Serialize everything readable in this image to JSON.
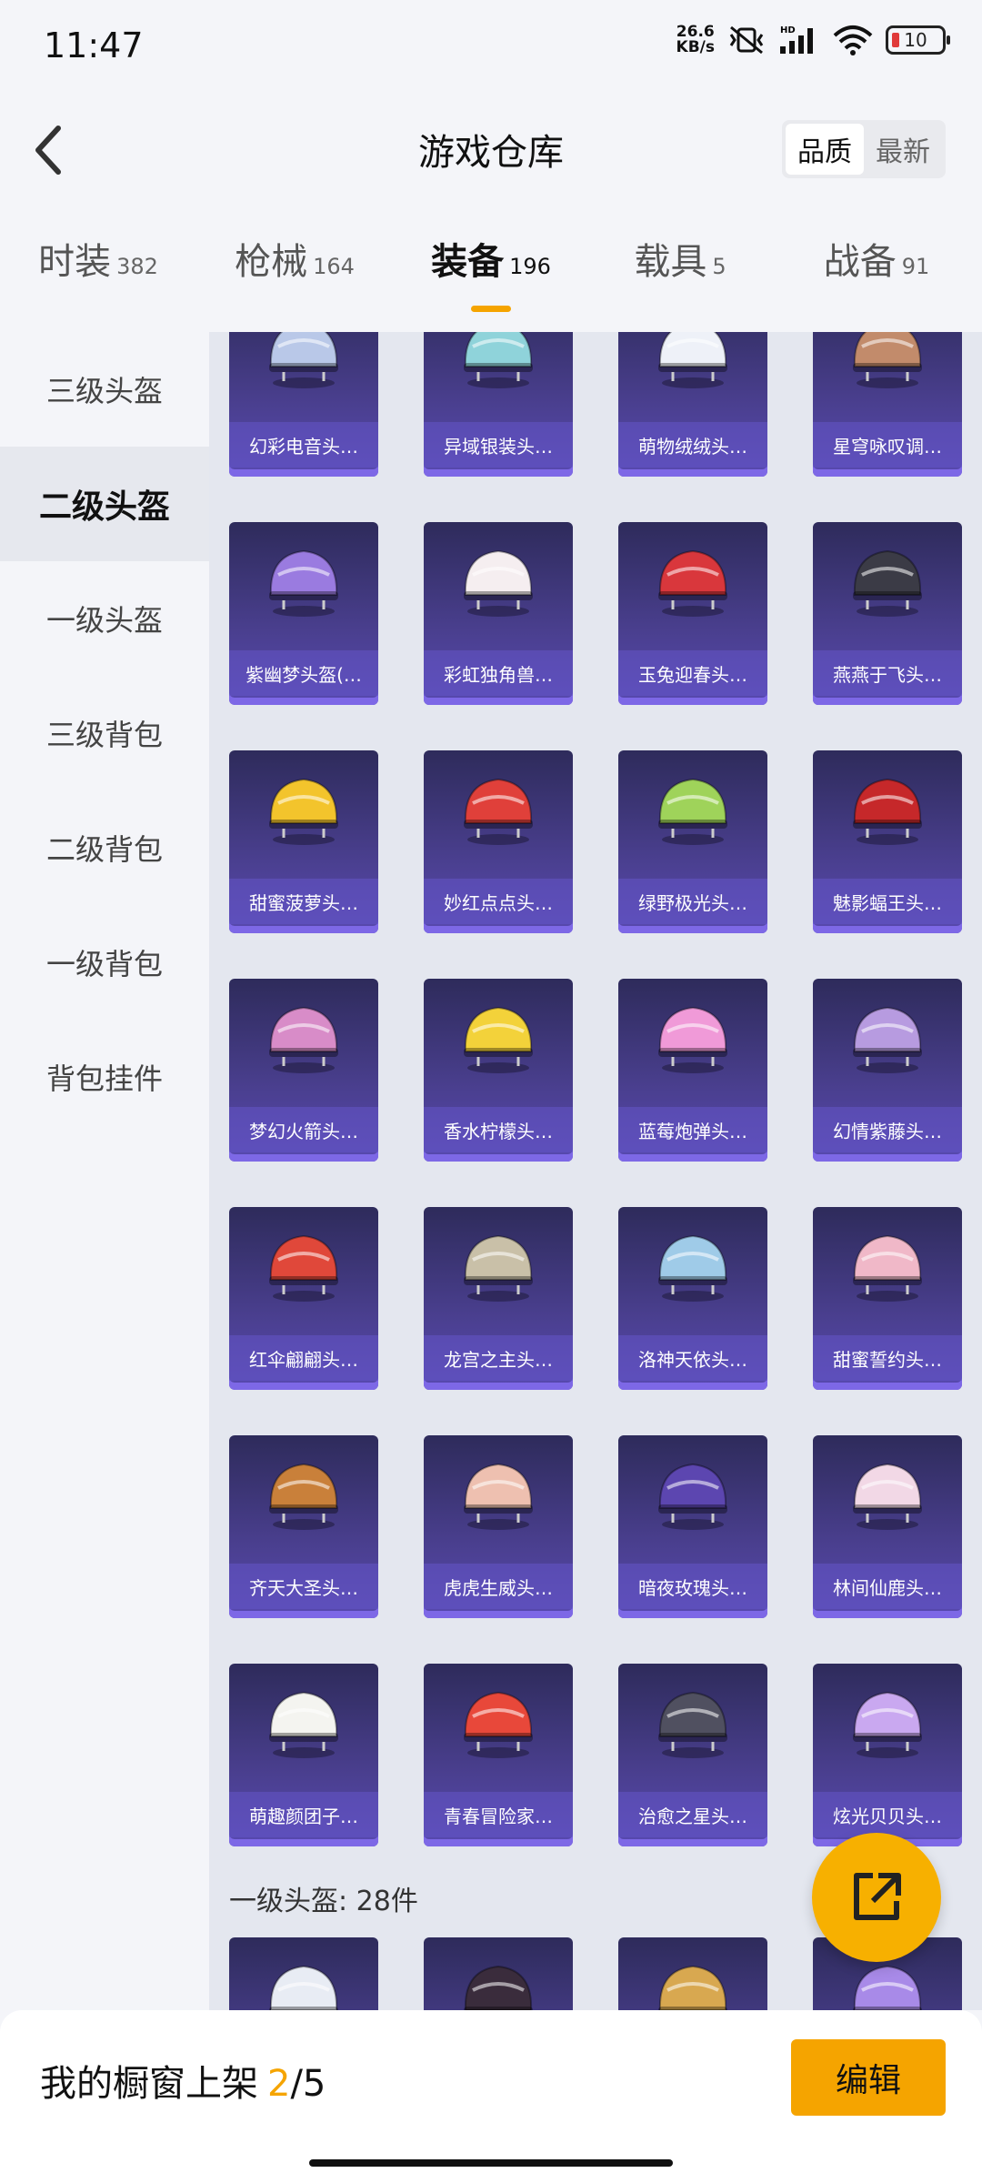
{
  "status": {
    "time": "11:47",
    "net_speed_value": "26.6",
    "net_speed_unit": "KB/s",
    "battery": "10"
  },
  "header": {
    "title": "游戏仓库",
    "sort_quality": "品质",
    "sort_latest": "最新"
  },
  "tabs": [
    {
      "label": "时装",
      "count": "382"
    },
    {
      "label": "枪械",
      "count": "164"
    },
    {
      "label": "装备",
      "count": "196"
    },
    {
      "label": "载具",
      "count": "5"
    },
    {
      "label": "战备",
      "count": "91"
    }
  ],
  "sidebar": [
    {
      "label": "三级头盔"
    },
    {
      "label": "二级头盔"
    },
    {
      "label": "一级头盔"
    },
    {
      "label": "三级背包"
    },
    {
      "label": "二级背包"
    },
    {
      "label": "一级背包"
    },
    {
      "label": "背包挂件"
    }
  ],
  "items": [
    {
      "name": "幻彩电音头…",
      "color": "#b9c8e8"
    },
    {
      "name": "异域银装头…",
      "color": "#8fd3da"
    },
    {
      "name": "萌物绒绒头…",
      "color": "#eef1f8"
    },
    {
      "name": "星穹咏叹调…",
      "color": "#c28b6b"
    },
    {
      "name": "紫幽梦头盔(…",
      "color": "#9a7be0"
    },
    {
      "name": "彩虹独角兽…",
      "color": "#f5eef0"
    },
    {
      "name": "玉兔迎春头…",
      "color": "#d9373c"
    },
    {
      "name": "燕燕于飞头…",
      "color": "#3b3b46"
    },
    {
      "name": "甜蜜菠萝头…",
      "color": "#f3c42c"
    },
    {
      "name": "妙红点点头…",
      "color": "#e0403a"
    },
    {
      "name": "绿野极光头…",
      "color": "#9fd35a"
    },
    {
      "name": "魅影蝠王头…",
      "color": "#c6282a"
    },
    {
      "name": "梦幻火箭头…",
      "color": "#d88cc8"
    },
    {
      "name": "香水柠檬头…",
      "color": "#f3d23a"
    },
    {
      "name": "蓝莓炮弹头…",
      "color": "#f09ad8"
    },
    {
      "name": "幻情紫藤头…",
      "color": "#b79be0"
    },
    {
      "name": "红伞翩翩头…",
      "color": "#e0483a"
    },
    {
      "name": "龙宫之主头…",
      "color": "#c9c0a8"
    },
    {
      "name": "洛神天依头…",
      "color": "#9fcbe8"
    },
    {
      "name": "甜蜜誓约头…",
      "color": "#f0b8c8"
    },
    {
      "name": "齐天大圣头…",
      "color": "#c9803a"
    },
    {
      "name": "虎虎生威头…",
      "color": "#eec0b0"
    },
    {
      "name": "暗夜玫瑰头…",
      "color": "#5c46b0"
    },
    {
      "name": "林间仙鹿头…",
      "color": "#f2d8e6"
    },
    {
      "name": "萌趣颜团子…",
      "color": "#f4f4f0"
    },
    {
      "name": "青春冒险家…",
      "color": "#e8483a"
    },
    {
      "name": "治愈之星头…",
      "color": "#505060"
    },
    {
      "name": "炫光贝贝头…",
      "color": "#c9a8f0"
    }
  ],
  "section": {
    "label": "一级头盔: 28件"
  },
  "items2": [
    {
      "color": "#e8ecf4"
    },
    {
      "color": "#3a2c3c"
    },
    {
      "color": "#d8a850"
    },
    {
      "color": "#a88ae8"
    }
  ],
  "bottom": {
    "showcase_label": "我的橱窗上架",
    "showcase_current": "2",
    "showcase_total": "/5",
    "edit_label": "编辑"
  },
  "colors": {
    "accent": "#f5a400",
    "card_top": "#2e2b5b",
    "card_bottom": "#5849b0"
  }
}
